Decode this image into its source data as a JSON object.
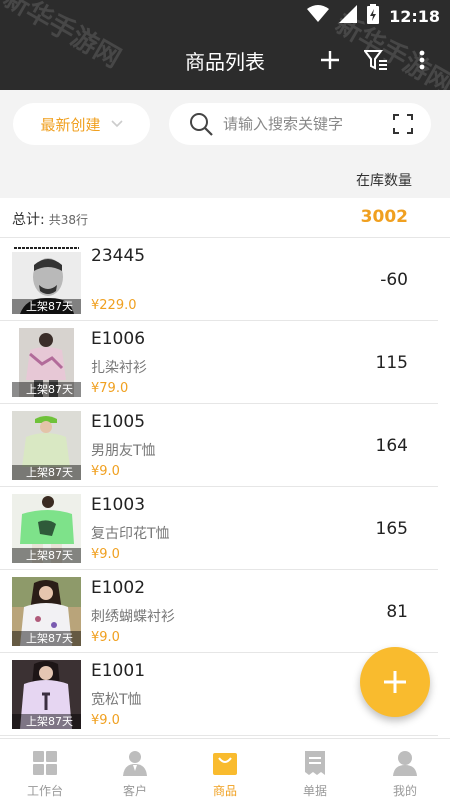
{
  "status_bar": {
    "time": "12:18"
  },
  "watermark": {
    "text": "新华手游网"
  },
  "app_bar": {
    "title": "商品列表"
  },
  "filter": {
    "sort_label": "最新创建",
    "search_placeholder": "请输入搜索关键字"
  },
  "list_header": {
    "stock_label": "在库数量"
  },
  "summary": {
    "label": "总计:",
    "rows": "共38行",
    "total_qty": "3002"
  },
  "products": [
    {
      "code": "23445",
      "name": "",
      "price": "¥229.0",
      "qty": "-60",
      "age": "上架87天"
    },
    {
      "code": "E1006",
      "name": "扎染衬衫",
      "price": "¥79.0",
      "qty": "115",
      "age": "上架87天"
    },
    {
      "code": "E1005",
      "name": "男朋友T恤",
      "price": "¥9.0",
      "qty": "164",
      "age": "上架87天"
    },
    {
      "code": "E1003",
      "name": "复古印花T恤",
      "price": "¥9.0",
      "qty": "165",
      "age": "上架87天"
    },
    {
      "code": "E1002",
      "name": "刺绣蝴蝶衬衫",
      "price": "¥9.0",
      "qty": "81",
      "age": "上架87天"
    },
    {
      "code": "E1001",
      "name": "宽松T恤",
      "price": "¥9.0",
      "qty": "",
      "age": "上架87天"
    }
  ],
  "bottom_nav": [
    {
      "label": "工作台",
      "icon": "grid-icon"
    },
    {
      "label": "客户",
      "icon": "person-icon"
    },
    {
      "label": "商品",
      "icon": "bag-icon"
    },
    {
      "label": "单据",
      "icon": "receipt-icon"
    },
    {
      "label": "我的",
      "icon": "user-icon"
    }
  ],
  "colors": {
    "accent": "#f0a020",
    "fab": "#f9bb2e",
    "appbar": "#2c2c2c"
  }
}
